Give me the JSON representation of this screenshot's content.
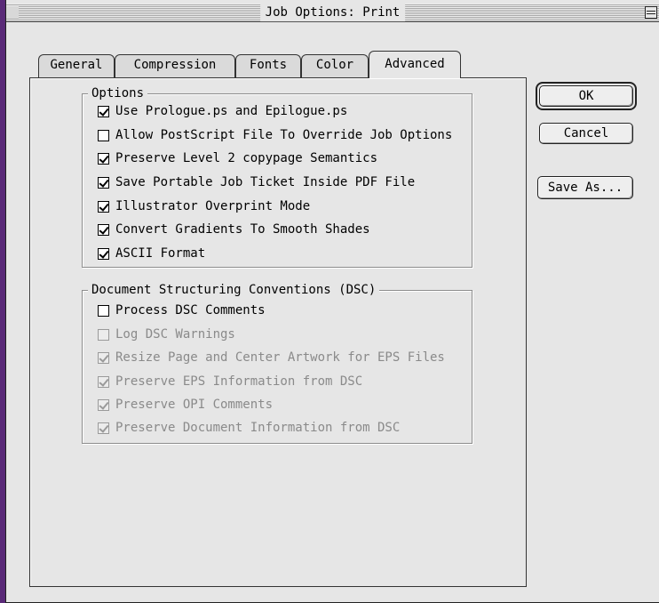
{
  "window": {
    "title": "Job Options: Print"
  },
  "tabs": [
    {
      "label": "General"
    },
    {
      "label": "Compression"
    },
    {
      "label": "Fonts"
    },
    {
      "label": "Color"
    },
    {
      "label": "Advanced",
      "active": true
    }
  ],
  "options_group": {
    "legend": "Options",
    "items": [
      {
        "label": "Use Prologue.ps and Epilogue.ps",
        "checked": true,
        "enabled": true
      },
      {
        "label": "Allow PostScript File To Override Job Options",
        "checked": false,
        "enabled": true
      },
      {
        "label": "Preserve Level 2 copypage Semantics",
        "checked": true,
        "enabled": true
      },
      {
        "label": "Save Portable Job Ticket Inside PDF File",
        "checked": true,
        "enabled": true
      },
      {
        "label": "Illustrator Overprint Mode",
        "checked": true,
        "enabled": true
      },
      {
        "label": "Convert Gradients To Smooth Shades",
        "checked": true,
        "enabled": true
      },
      {
        "label": "ASCII Format",
        "checked": true,
        "enabled": true
      }
    ]
  },
  "dsc_group": {
    "legend": "Document Structuring Conventions (DSC)",
    "items": [
      {
        "label": "Process DSC Comments",
        "checked": false,
        "enabled": true
      },
      {
        "label": "Log DSC Warnings",
        "checked": false,
        "enabled": false
      },
      {
        "label": "Resize Page and Center Artwork for EPS Files",
        "checked": true,
        "enabled": false
      },
      {
        "label": "Preserve EPS Information from DSC",
        "checked": true,
        "enabled": false
      },
      {
        "label": "Preserve OPI Comments",
        "checked": true,
        "enabled": false
      },
      {
        "label": "Preserve Document Information from DSC",
        "checked": true,
        "enabled": false
      }
    ]
  },
  "buttons": {
    "ok": "OK",
    "cancel": "Cancel",
    "save_as": "Save As..."
  }
}
